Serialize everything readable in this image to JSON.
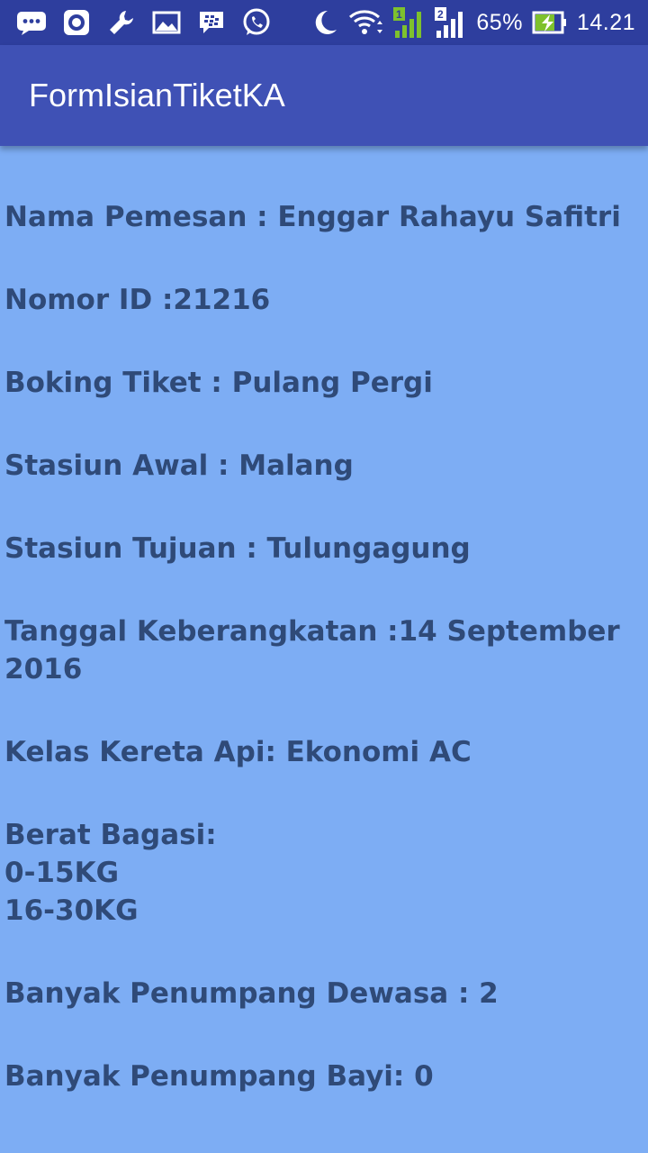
{
  "status_bar": {
    "icons": [
      "message-icon",
      "camera-icon",
      "wrench-icon",
      "gallery-icon",
      "bbm-icon",
      "whatsapp-icon",
      "moon-icon",
      "wifi-icon",
      "signal-sim1-icon",
      "signal-sim2-icon",
      "battery-charging-icon"
    ],
    "battery_percent": "65%",
    "time": "14.21",
    "sim1_label": "1",
    "sim2_label": "2"
  },
  "app_bar": {
    "title": "FormIsianTiketKA"
  },
  "details": {
    "nama_pemesan": "Nama Pemesan : Enggar Rahayu Safitri",
    "nomor_id": "Nomor ID :21216",
    "boking_tiket": "Boking Tiket : Pulang Pergi",
    "stasiun_awal": "Stasiun Awal : Malang",
    "stasiun_tujuan": "Stasiun Tujuan : Tulungagung",
    "tanggal_keberangkatan": "Tanggal Keberangkatan :14 September\n2016",
    "kelas_kereta_api": "Kelas Kereta Api: Ekonomi AC",
    "berat_bagasi": "Berat Bagasi:\n0-15KG\n16-30KG",
    "penumpang_dewasa": "Banyak Penumpang Dewasa : 2",
    "penumpang_bayi": "Banyak Penumpang Bayi: 0"
  },
  "colors": {
    "status_bar": "#2e3e9e",
    "app_bar": "#3f51b5",
    "background": "#7dadf4",
    "text": "#2f4a78",
    "battery_green": "#7ec12d"
  }
}
